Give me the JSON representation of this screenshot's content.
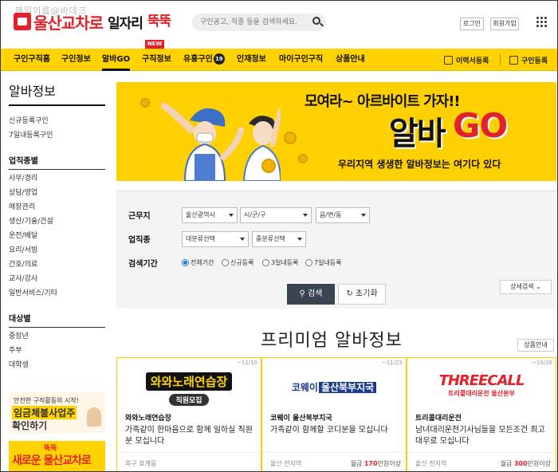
{
  "header": {
    "watermark": "메일이름@바데크",
    "logo_main": "울산교차로",
    "logo_sub": "일자리",
    "logo_tt": "뚝뚝",
    "search_placeholder": "구인공고, 직종 등을 검색하세요.",
    "login": "로그인",
    "signup": "회원가입"
  },
  "nav": {
    "new_badge": "NEW",
    "items": [
      "구인구직홈",
      "구인정보",
      "알바GO",
      "구직정보",
      "유흥구인",
      "인재정보",
      "마이구인구직",
      "상품안내"
    ],
    "adult_count": "19",
    "resume": "이력서등록",
    "post_job": "구인등록"
  },
  "sidebar": {
    "title": "알바정보",
    "links": [
      "신규등록구인",
      "7일내등록구인"
    ],
    "job_header": "업직종별",
    "jobs": [
      "사무/경리",
      "상담/영업",
      "매장관리",
      "생산/기술/건설",
      "운전/배달",
      "요리/서빙",
      "간호/의료",
      "교사/강사",
      "일반서비스/기타"
    ],
    "target_header": "대상별",
    "targets": [
      "중장년",
      "주부",
      "대학생"
    ],
    "banner1": {
      "line1": "안전한 구직활동의 시작!",
      "line2": "임금체불사업주",
      "line3": "확인하기"
    },
    "banner2": {
      "line1": "뚝뚝",
      "line2": "새로운 울산교차로"
    }
  },
  "hero": {
    "line1": "모여라~ 아르바이트 가자!!",
    "line2a": "알바",
    "line2b": "GO",
    "line3": "우리지역 생생한 알바정보는 여기다 있다"
  },
  "form": {
    "work_label": "근무지",
    "work_selects": [
      "울산광역시",
      "시/군/구",
      "읍/면/동"
    ],
    "job_label": "업직종",
    "job_selects": [
      "대분류선택",
      "중분류선택"
    ],
    "period_label": "검색기간",
    "periods": [
      "전체기간",
      "신규등록",
      "3일내등록",
      "7일내등록"
    ],
    "detail": "상세검색",
    "search_btn": "검색",
    "reset_btn": "초기화"
  },
  "premium": {
    "title": "프리미엄 알바정보",
    "product_btn": "상품안내",
    "cards": [
      {
        "date": "~11/10",
        "logo_a": "와와노래연습장",
        "logo_b": "직원모집",
        "name": "와와노래연습장",
        "desc": "가족같이 한마음으로 함께 일하실 직원분 모십니다",
        "loc": "북구 호계동",
        "pay_prefix": "",
        "pay_amount": "",
        "pay_unit": ""
      },
      {
        "date": "~11/23",
        "logo_a": "코웨이",
        "logo_b": "울산북부지국",
        "name": "코웨이 울산북부지국",
        "desc": "가족같이 함께할 코디분을 모십니다",
        "loc": "울산 전지역",
        "pay_prefix": "월급 ",
        "pay_amount": "170",
        "pay_unit": "만원이상"
      },
      {
        "date": "~10/28",
        "logo_a": "THREECALL",
        "logo_b": "트리콜대리운전 울산본부",
        "name": "트리콜대리운전",
        "desc": "남녀대리운전기사님들을 모든조건 최고대우로 모십니다",
        "loc": "울산 전지역",
        "pay_prefix": "월급 ",
        "pay_amount": "300",
        "pay_unit": "만원이상"
      }
    ]
  },
  "colors": {
    "brand_red": "#e4202a",
    "brand_yellow": "#ffd200",
    "search_btn": "#3a4350"
  }
}
